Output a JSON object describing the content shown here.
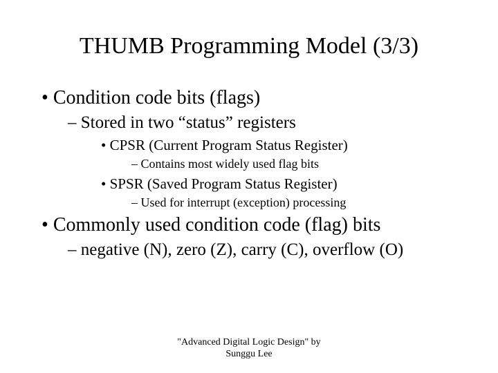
{
  "title": "THUMB Programming Model (3/3)",
  "bullets": {
    "b1": "Condition code bits (flags)",
    "b1_1": "Stored in two “status” registers",
    "b1_1_1": "CPSR (Current Program Status Register)",
    "b1_1_1_1": "Contains most widely used flag bits",
    "b1_1_2": "SPSR (Saved Program Status Register)",
    "b1_1_2_1": "Used for interrupt (exception) processing",
    "b2": "Commonly used condition code (flag) bits",
    "b2_1": "negative (N), zero (Z), carry (C), overflow (O)"
  },
  "footer_line1": "\"Advanced Digital Logic Design\" by",
  "footer_line2": "Sunggu Lee"
}
